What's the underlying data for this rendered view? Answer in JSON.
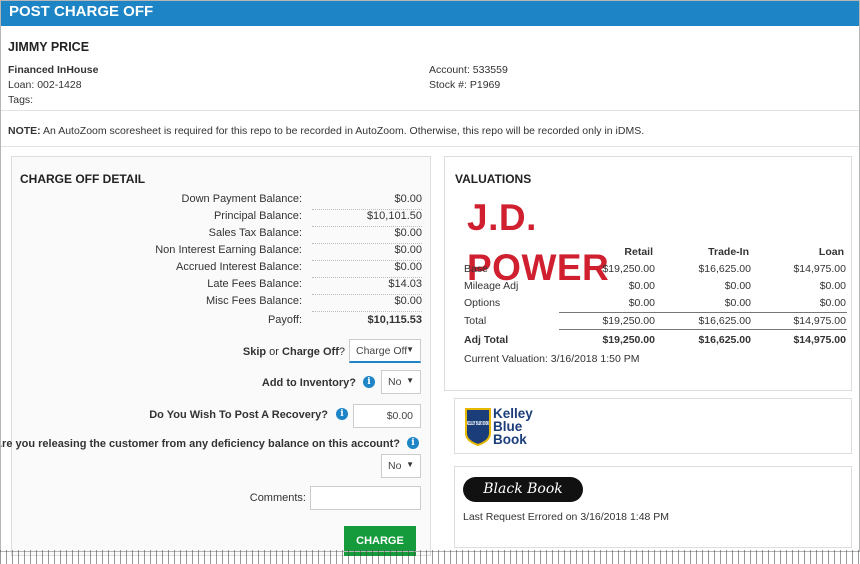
{
  "window": {
    "title": "POST CHARGE OFF"
  },
  "customer": {
    "name": "JIMMY PRICE",
    "finance_type": "Financed InHouse",
    "loan": "Loan: 002-1428",
    "tags": "Tags:",
    "account": "Account: 533559",
    "stock": "Stock #: P1969"
  },
  "note": {
    "label": "NOTE:",
    "text": " An AutoZoom scoresheet is required for this repo to be recorded in AutoZoom. Otherwise, this repo will be recorded only in iDMS."
  },
  "charge_off_detail": {
    "title": "CHARGE OFF DETAIL",
    "balances": [
      {
        "label": "Down Payment Balance:",
        "value": "$0.00"
      },
      {
        "label": "Principal Balance:",
        "value": "$10,101.50"
      },
      {
        "label": "Sales Tax Balance:",
        "value": "$0.00"
      },
      {
        "label": "Non Interest Earning Balance:",
        "value": "$0.00"
      },
      {
        "label": "Accrued Interest Balance:",
        "value": "$0.00"
      },
      {
        "label": "Late Fees Balance:",
        "value": "$14.03"
      },
      {
        "label": "Misc Fees Balance:",
        "value": "$0.00"
      },
      {
        "label": "Payoff:",
        "value": "$10,115.53"
      }
    ],
    "skip_question": {
      "skip": "Skip",
      "or": " or ",
      "charge_off": "Charge Off",
      "qmark": "?"
    },
    "skip_select": "Charge Off",
    "inventory_label": "Add to Inventory?",
    "inventory_select": "No",
    "recovery_label": "Do You Wish To Post A Recovery?",
    "recovery_value": "$0.00",
    "deficiency_label": "Are you releasing the customer from any deficiency balance on this account?",
    "deficiency_select": "No",
    "comments_label": "Comments:",
    "comments_value": "",
    "submit_label": "CHARGE OFF"
  },
  "valuations": {
    "title": "VALUATIONS",
    "jd_power_logo": "J.D. POWER",
    "columns": [
      "Retail",
      "Trade-In",
      "Loan"
    ],
    "rows": [
      {
        "label": "Base",
        "values": [
          "$19,250.00",
          "$16,625.00",
          "$14,975.00"
        ]
      },
      {
        "label": "Mileage Adj",
        "values": [
          "$0.00",
          "$0.00",
          "$0.00"
        ]
      },
      {
        "label": "Options",
        "values": [
          "$0.00",
          "$0.00",
          "$0.00"
        ]
      },
      {
        "label": "Total",
        "values": [
          "$19,250.00",
          "$16,625.00",
          "$14,975.00"
        ]
      },
      {
        "label": "Adj Total",
        "values": [
          "$19,250.00",
          "$16,625.00",
          "$14,975.00"
        ]
      }
    ],
    "current_valuation": "Current Valuation: 3/16/2018 1:50 PM",
    "kbb": {
      "line1": "Kelley",
      "line2": "Blue",
      "line3": "Book",
      "badge": "KELLEY BLUE BOOK"
    },
    "black_book": {
      "logo": "Black Book",
      "status": "Last Request Errored on 3/16/2018 1:48 PM"
    }
  },
  "colors": {
    "header": "#1d85c6",
    "button": "#159b3c",
    "jd_power_red": "#d02030",
    "kbb_blue": "#1b3e7a"
  }
}
